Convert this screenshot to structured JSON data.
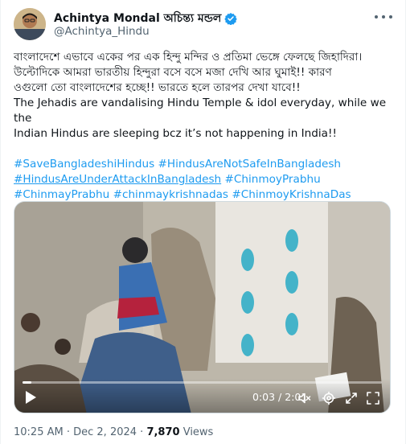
{
  "author": {
    "display_name": "Achintya Mondal অচিন্ত্য মন্ডল",
    "handle": "@Achintya_Hindu",
    "verified": true
  },
  "tweet": {
    "lines_bengali": [
      "বাংলাদেশে এভাবে একের পর এক হিন্দু মন্দির ও প্রতিমা ভেঙ্গে ফেলছে জিহাদিরা।",
      "উল্টোদিকে আমরা ভারতীয় হিন্দুরা বসে বসে মজা দেখি আর ঘুমাই!! কারণ",
      "ওগুলো তো বাংলাদেশের হচ্ছে!! ভারতে হলে তারপর দেখা যাবে!!"
    ],
    "lines_english": [
      "The Jehadis are vandalising Hindu Temple & idol everyday, while we the",
      "Indian Hindus are sleeping bcz it’s not happening in India!!"
    ],
    "hashtags": [
      "#SaveBangladeshiHindus",
      "#HindusAreNotSafeInBangladesh",
      "#HindusAreUnderAttackInBangladesh",
      "#ChinmoyPrabhu",
      "#ChinmayPrabhu",
      "#chinmaykrishnadas",
      "#ChinmoyKrishnaDas"
    ]
  },
  "video": {
    "current_time": "0:03",
    "duration": "2:01",
    "time_separator": " / ",
    "progress": 0.025,
    "icons": [
      "play-icon",
      "volume-muted-icon",
      "settings-gear-icon",
      "fullscreen-icon",
      "expand-icon"
    ]
  },
  "meta": {
    "time": "10:25 AM",
    "separator": " · ",
    "date": "Dec 2, 2024",
    "views_count": "7,870",
    "views_label": " Views"
  },
  "colors": {
    "link": "#1d9bf0",
    "text": "#0f1419",
    "secondary": "#536471",
    "verified": "#1d9bf0"
  }
}
